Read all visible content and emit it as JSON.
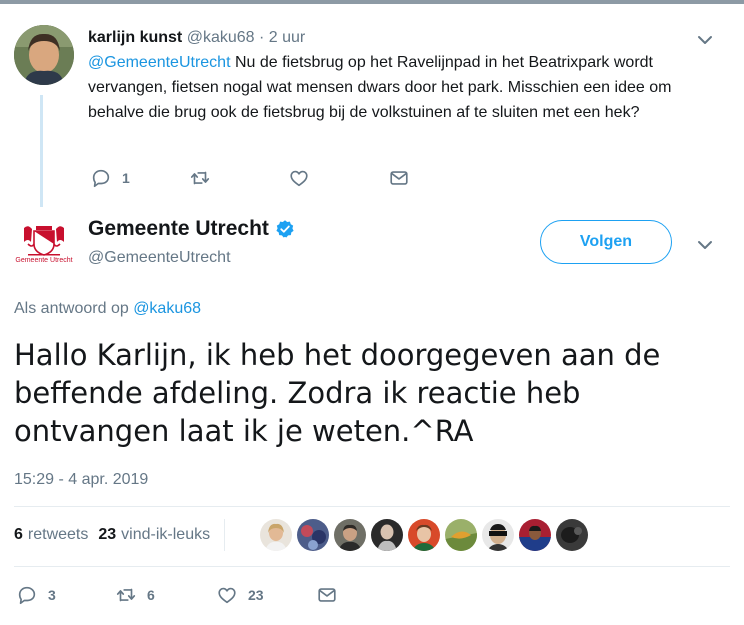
{
  "reply_tweet": {
    "display_name": "karlijn kunst",
    "handle": "@kaku68",
    "time_separator": " · ",
    "time": "2 uur",
    "mention": "@GemeenteUtrecht",
    "text": " Nu de fietsbrug op het Ravelijnpad in het Beatrixpark wordt vervangen, fietsen nogal wat mensen dwars door het park. Misschien een idee om behalve die brug ook de fietsbrug bij de volkstuinen af te sluiten met een hek?",
    "reply_count": "1",
    "retweet_count": "",
    "like_count": ""
  },
  "main_tweet": {
    "display_name": "Gemeente Utrecht",
    "handle": "@GemeenteUtrecht",
    "logo_text": "Gemeente Utrecht",
    "follow_label": "Volgen",
    "reply_prefix": "Als antwoord op ",
    "reply_mention": "@kaku68",
    "text": "Hallo Karlijn, ik heb het doorgegeven aan de beffende afdeling. Zodra ik reactie heb ontvangen laat ik je weten.^RA",
    "timestamp": "15:29 - 4 apr. 2019",
    "retweets_count": "6",
    "retweets_label": "retweets",
    "likes_count": "23",
    "likes_label": "vind-ik-leuks",
    "reply_count": "3",
    "retweet_count": "6",
    "like_count": "23"
  },
  "colors": {
    "accent": "#1da1f2",
    "link": "#1b95e0",
    "muted": "#657786",
    "divider": "#e6ecf0",
    "thread_line": "#cfe6f5"
  },
  "icons": [
    "chevron-down-icon",
    "reply-icon",
    "retweet-icon",
    "like-icon",
    "message-icon",
    "verified-icon"
  ]
}
